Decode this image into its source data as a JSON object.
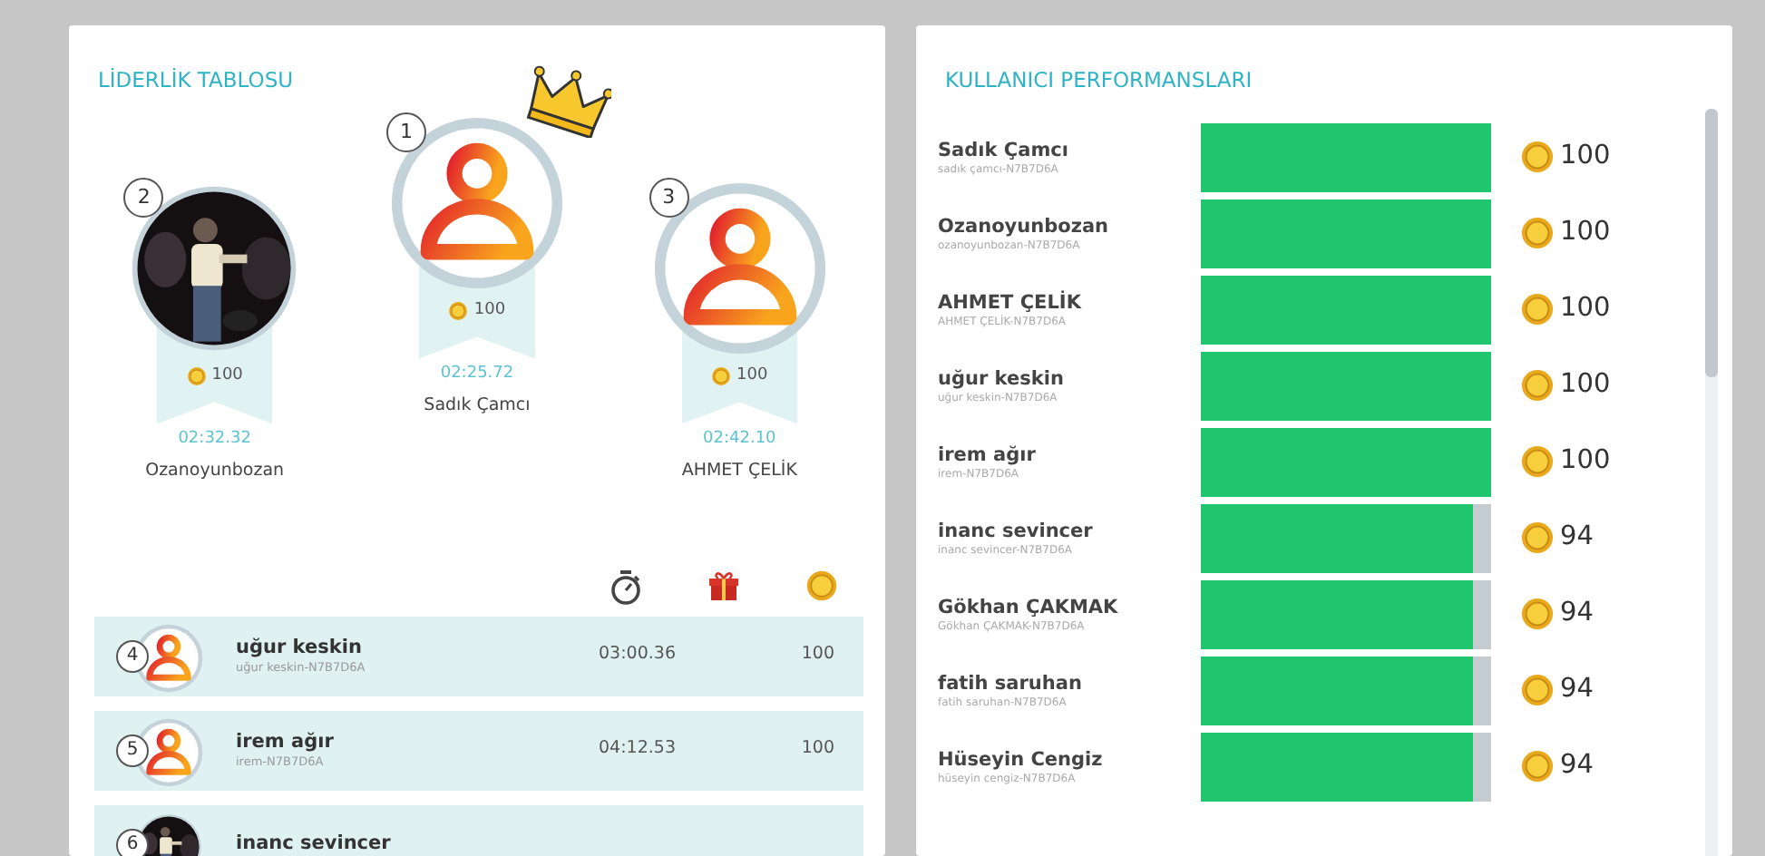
{
  "leaderboard": {
    "title": "LİDERLİK TABLOSU",
    "podium": [
      {
        "rank": "2",
        "name": "Ozanoyunbozan",
        "score": "100",
        "time": "02:32.32",
        "crowned": false
      },
      {
        "rank": "1",
        "name": "Sadık Çamcı",
        "score": "100",
        "time": "02:25.72",
        "avatar": {
          "kind": "default"
        },
        "crowned": true
      },
      {
        "rank": "3",
        "name": "AHMET ÇELİK",
        "score": "100",
        "time": "02:42.10",
        "avatar": {
          "kind": "default"
        },
        "crowned": false
      }
    ],
    "rows": [
      {
        "rank": "4",
        "name": "uğur keskin",
        "username": "uğur keskin-N7B7D6A",
        "time": "03:00.36",
        "score": "100",
        "avatar": {
          "kind": "default"
        }
      },
      {
        "rank": "5",
        "name": "irem ağır",
        "username": "irem-N7B7D6A",
        "time": "04:12.53",
        "score": "100",
        "avatar": {
          "kind": "default"
        }
      },
      {
        "rank": "6",
        "name": "inanc sevincer"
      }
    ]
  },
  "performance": {
    "title": "KULLANICI PERFORMANSLARI",
    "rows": [
      {
        "name": "Sadık Çamcı",
        "username": "sadık çamcı-N7B7D6A",
        "level": 1,
        "score": "100"
      },
      {
        "name": "Ozanoyunbozan",
        "username": "ozanoyunbozan-N7B7D6A",
        "level": 1,
        "score": "100"
      },
      {
        "name": "AHMET ÇELİK",
        "username": "AHMET ÇELİK-N7B7D6A",
        "level": 1,
        "score": "100"
      },
      {
        "name": "uğur keskin",
        "username": "uğur keskin-N7B7D6A",
        "level": 1,
        "score": "100"
      },
      {
        "name": "irem ağır",
        "username": "irem-N7B7D6A",
        "level": 1,
        "score": "100"
      },
      {
        "name": "inanc sevincer",
        "username": "inanc sevincer-N7B7D6A",
        "level": 0.94,
        "score": "94"
      },
      {
        "name": "Gökhan ÇAKMAK",
        "username": "Gökhan ÇAKMAK-N7B7D6A",
        "level": 0.94,
        "score": "94"
      },
      {
        "name": "fatih saruhan",
        "username": "fatih saruhan-N7B7D6A",
        "level": 0.94,
        "score": "94"
      },
      {
        "name": "Hüseyin Cengiz",
        "username": "hüseyin cengiz-N7B7D6A",
        "level": 0.94,
        "score": "94"
      }
    ]
  }
}
